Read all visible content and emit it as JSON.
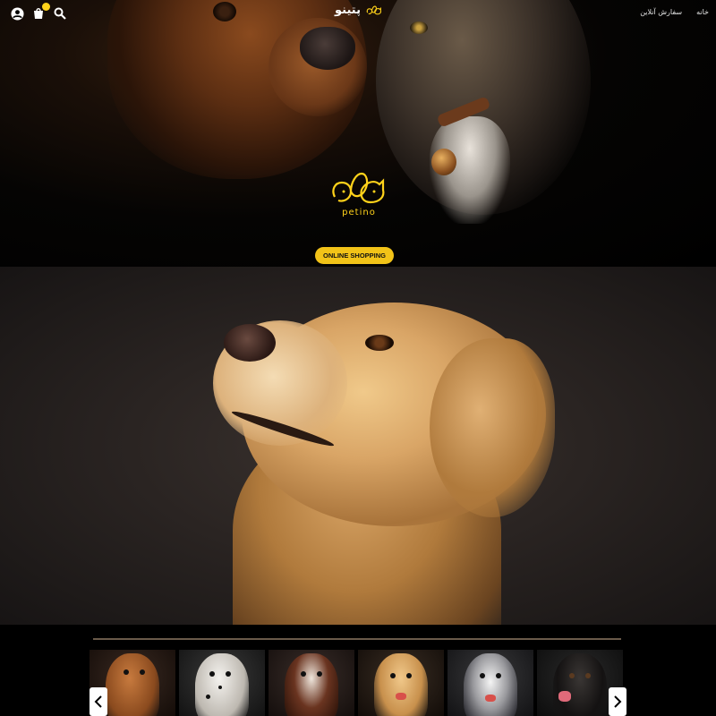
{
  "header": {
    "brand_name": "پتینو",
    "nav_links": [
      "خانه",
      "سفارش آنلاین"
    ]
  },
  "hero": {
    "logo_text": "petino",
    "cta_label": "ONLINE SHOPPING"
  },
  "colors": {
    "accent": "#f2c318",
    "logo": "#ffd21a",
    "background": "#000000"
  },
  "carousel": {
    "items": [
      {
        "icon": "boxer-dog-photo"
      },
      {
        "icon": "dalmatian-photo"
      },
      {
        "icon": "spaniel-photo"
      },
      {
        "icon": "golden-retriever-photo"
      },
      {
        "icon": "husky-photo"
      },
      {
        "icon": "black-labrador-photo"
      }
    ]
  },
  "icons": [
    "user-icon",
    "cart-icon",
    "search-icon",
    "chevron-left-icon",
    "chevron-right-icon"
  ]
}
